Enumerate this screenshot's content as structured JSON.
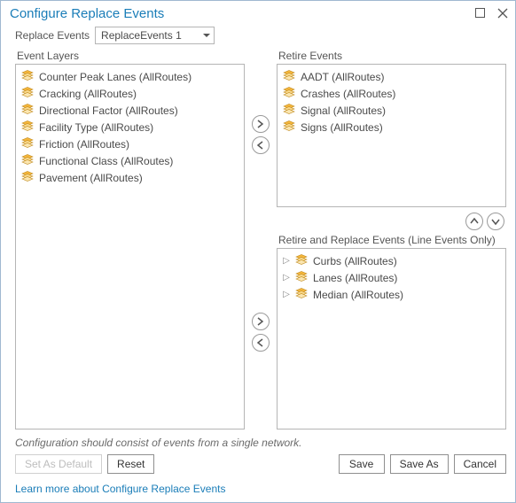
{
  "titlebar": {
    "title": "Configure Replace Events"
  },
  "selector": {
    "label": "Replace Events",
    "value": "ReplaceEvents 1"
  },
  "panels": {
    "event_layers": {
      "label": "Event Layers",
      "items": [
        {
          "label": "Counter Peak Lanes (AllRoutes)"
        },
        {
          "label": "Cracking (AllRoutes)"
        },
        {
          "label": "Directional Factor (AllRoutes)"
        },
        {
          "label": "Facility Type (AllRoutes)"
        },
        {
          "label": "Friction (AllRoutes)"
        },
        {
          "label": "Functional Class (AllRoutes)"
        },
        {
          "label": "Pavement (AllRoutes)"
        }
      ]
    },
    "retire_events": {
      "label": "Retire Events",
      "items": [
        {
          "label": "AADT (AllRoutes)"
        },
        {
          "label": "Crashes (AllRoutes)"
        },
        {
          "label": "Signal (AllRoutes)"
        },
        {
          "label": "Signs (AllRoutes)"
        }
      ]
    },
    "retire_replace": {
      "label": "Retire and Replace Events (Line Events Only)",
      "items": [
        {
          "label": "Curbs (AllRoutes)"
        },
        {
          "label": "Lanes (AllRoutes)"
        },
        {
          "label": "Median (AllRoutes)"
        }
      ]
    }
  },
  "hint": "Configuration should consist of events from a single network.",
  "buttons": {
    "set_default": "Set As Default",
    "reset": "Reset",
    "save": "Save",
    "save_as": "Save As",
    "cancel": "Cancel"
  },
  "link": "Learn more about Configure Replace Events"
}
